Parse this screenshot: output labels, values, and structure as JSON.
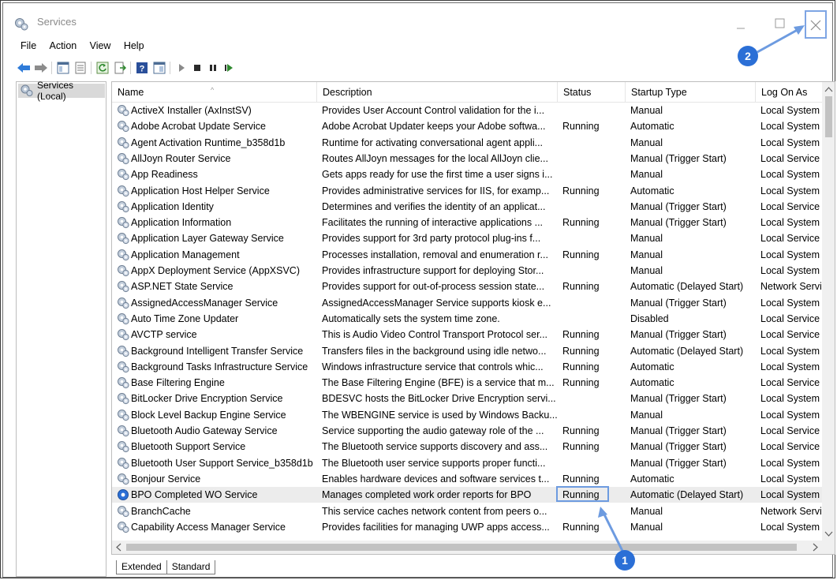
{
  "window": {
    "title": "Services"
  },
  "menu": [
    "File",
    "Action",
    "View",
    "Help"
  ],
  "left_pane": {
    "tree_item": "Services (Local)"
  },
  "columns": [
    "Name",
    "Description",
    "Status",
    "Startup Type",
    "Log On As"
  ],
  "rows": [
    {
      "name": "ActiveX Installer (AxInstSV)",
      "desc": "Provides User Account Control validation for the i...",
      "status": "",
      "startup": "Manual",
      "logon": "Local System"
    },
    {
      "name": "Adobe Acrobat Update Service",
      "desc": "Adobe Acrobat Updater keeps your Adobe softwa...",
      "status": "Running",
      "startup": "Automatic",
      "logon": "Local System"
    },
    {
      "name": "Agent Activation Runtime_b358d1b",
      "desc": "Runtime for activating conversational agent appli...",
      "status": "",
      "startup": "Manual",
      "logon": "Local System"
    },
    {
      "name": "AllJoyn Router Service",
      "desc": "Routes AllJoyn messages for the local AllJoyn clie...",
      "status": "",
      "startup": "Manual (Trigger Start)",
      "logon": "Local Service"
    },
    {
      "name": "App Readiness",
      "desc": "Gets apps ready for use the first time a user signs i...",
      "status": "",
      "startup": "Manual",
      "logon": "Local System"
    },
    {
      "name": "Application Host Helper Service",
      "desc": "Provides administrative services for IIS, for examp...",
      "status": "Running",
      "startup": "Automatic",
      "logon": "Local System"
    },
    {
      "name": "Application Identity",
      "desc": "Determines and verifies the identity of an applicat...",
      "status": "",
      "startup": "Manual (Trigger Start)",
      "logon": "Local Service"
    },
    {
      "name": "Application Information",
      "desc": "Facilitates the running of interactive applications ...",
      "status": "Running",
      "startup": "Manual (Trigger Start)",
      "logon": "Local System"
    },
    {
      "name": "Application Layer Gateway Service",
      "desc": "Provides support for 3rd party protocol plug-ins f...",
      "status": "",
      "startup": "Manual",
      "logon": "Local Service"
    },
    {
      "name": "Application Management",
      "desc": "Processes installation, removal and enumeration r...",
      "status": "Running",
      "startup": "Manual",
      "logon": "Local System"
    },
    {
      "name": "AppX Deployment Service (AppXSVC)",
      "desc": "Provides infrastructure support for deploying Stor...",
      "status": "",
      "startup": "Manual",
      "logon": "Local System"
    },
    {
      "name": "ASP.NET State Service",
      "desc": "Provides support for out-of-process session state...",
      "status": "Running",
      "startup": "Automatic (Delayed Start)",
      "logon": "Network Servi"
    },
    {
      "name": "AssignedAccessManager Service",
      "desc": "AssignedAccessManager Service supports kiosk e...",
      "status": "",
      "startup": "Manual (Trigger Start)",
      "logon": "Local System"
    },
    {
      "name": "Auto Time Zone Updater",
      "desc": "Automatically sets the system time zone.",
      "status": "",
      "startup": "Disabled",
      "logon": "Local Service"
    },
    {
      "name": "AVCTP service",
      "desc": "This is Audio Video Control Transport Protocol ser...",
      "status": "Running",
      "startup": "Manual (Trigger Start)",
      "logon": "Local Service"
    },
    {
      "name": "Background Intelligent Transfer Service",
      "desc": "Transfers files in the background using idle netwo...",
      "status": "Running",
      "startup": "Automatic (Delayed Start)",
      "logon": "Local System"
    },
    {
      "name": "Background Tasks Infrastructure Service",
      "desc": "Windows infrastructure service that controls whic...",
      "status": "Running",
      "startup": "Automatic",
      "logon": "Local System"
    },
    {
      "name": "Base Filtering Engine",
      "desc": "The Base Filtering Engine (BFE) is a service that m...",
      "status": "Running",
      "startup": "Automatic",
      "logon": "Local Service"
    },
    {
      "name": "BitLocker Drive Encryption Service",
      "desc": "BDESVC hosts the BitLocker Drive Encryption servi...",
      "status": "",
      "startup": "Manual (Trigger Start)",
      "logon": "Local System"
    },
    {
      "name": "Block Level Backup Engine Service",
      "desc": "The WBENGINE service is used by Windows Backu...",
      "status": "",
      "startup": "Manual",
      "logon": "Local System"
    },
    {
      "name": "Bluetooth Audio Gateway Service",
      "desc": "Service supporting the audio gateway role of the ...",
      "status": "Running",
      "startup": "Manual (Trigger Start)",
      "logon": "Local Service"
    },
    {
      "name": "Bluetooth Support Service",
      "desc": "The Bluetooth service supports discovery and ass...",
      "status": "Running",
      "startup": "Manual (Trigger Start)",
      "logon": "Local Service"
    },
    {
      "name": "Bluetooth User Support Service_b358d1b",
      "desc": "The Bluetooth user service supports proper functi...",
      "status": "",
      "startup": "Manual (Trigger Start)",
      "logon": "Local System"
    },
    {
      "name": "Bonjour Service",
      "desc": "Enables hardware devices and software services t...",
      "status": "Running",
      "startup": "Automatic",
      "logon": "Local System"
    },
    {
      "name": "BPO Completed WO Service",
      "desc": "Manages completed work order reports for BPO",
      "status": "Running",
      "startup": "Automatic (Delayed Start)",
      "logon": "Local System",
      "selected": true
    },
    {
      "name": "BranchCache",
      "desc": "This service caches network content from peers o...",
      "status": "",
      "startup": "Manual",
      "logon": "Network Servi"
    },
    {
      "name": "Capability Access Manager Service",
      "desc": "Provides facilities for managing UWP apps access...",
      "status": "Running",
      "startup": "Manual",
      "logon": "Local System"
    }
  ],
  "tabs": [
    "Extended",
    "Standard"
  ],
  "annotations": {
    "badge1": "1",
    "badge2": "2"
  },
  "colors": {
    "accent": "#2b6fd6",
    "highlight": "#6d9be0"
  }
}
